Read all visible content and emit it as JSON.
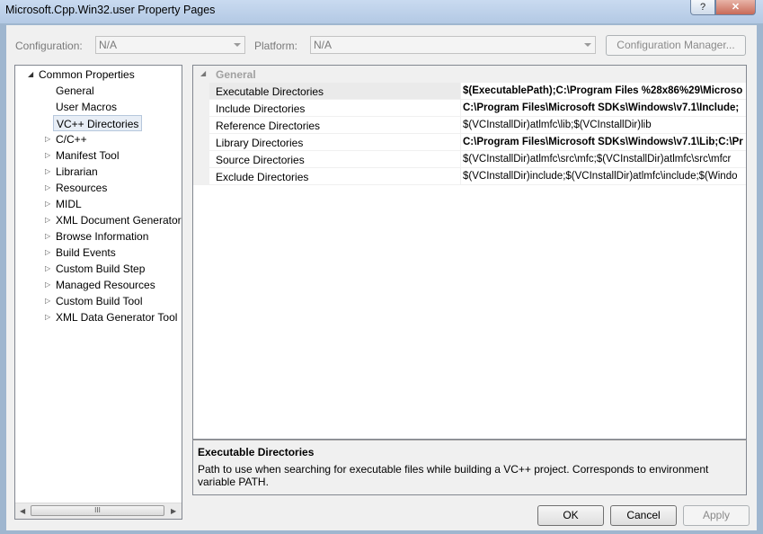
{
  "window": {
    "title": "Microsoft.Cpp.Win32.user Property Pages",
    "help_glyph": "?",
    "close_glyph": "✕"
  },
  "config_row": {
    "configuration_label": "Configuration:",
    "configuration_value": "N/A",
    "platform_label": "Platform:",
    "platform_value": "N/A",
    "config_manager_label": "Configuration Manager..."
  },
  "tree": {
    "root": "Common Properties",
    "items": [
      {
        "label": "General",
        "expandable": false
      },
      {
        "label": "User Macros",
        "expandable": false
      },
      {
        "label": "VC++ Directories",
        "expandable": false,
        "selected": true
      },
      {
        "label": "C/C++",
        "expandable": true
      },
      {
        "label": "Manifest Tool",
        "expandable": true
      },
      {
        "label": "Librarian",
        "expandable": true
      },
      {
        "label": "Resources",
        "expandable": true
      },
      {
        "label": "MIDL",
        "expandable": true
      },
      {
        "label": "XML Document Generator",
        "expandable": true
      },
      {
        "label": "Browse Information",
        "expandable": true
      },
      {
        "label": "Build Events",
        "expandable": true
      },
      {
        "label": "Custom Build Step",
        "expandable": true
      },
      {
        "label": "Managed Resources",
        "expandable": true
      },
      {
        "label": "Custom Build Tool",
        "expandable": true
      },
      {
        "label": "XML Data Generator Tool",
        "expandable": true
      }
    ],
    "scroll_grip": "III"
  },
  "grid": {
    "category": "General",
    "rows": [
      {
        "name": "Executable Directories",
        "value": "$(ExecutablePath);C:\\Program Files %28x86%29\\Microso",
        "bold": true,
        "selected": true
      },
      {
        "name": "Include Directories",
        "value": "C:\\Program Files\\Microsoft SDKs\\Windows\\v7.1\\Include;",
        "bold": true
      },
      {
        "name": "Reference Directories",
        "value": "$(VCInstallDir)atlmfc\\lib;$(VCInstallDir)lib",
        "bold": false
      },
      {
        "name": "Library Directories",
        "value": "C:\\Program Files\\Microsoft SDKs\\Windows\\v7.1\\Lib;C:\\Pr",
        "bold": true
      },
      {
        "name": "Source Directories",
        "value": "$(VCInstallDir)atlmfc\\src\\mfc;$(VCInstallDir)atlmfc\\src\\mfcr",
        "bold": false
      },
      {
        "name": "Exclude Directories",
        "value": "$(VCInstallDir)include;$(VCInstallDir)atlmfc\\include;$(Windo",
        "bold": false
      }
    ]
  },
  "description": {
    "title": "Executable Directories",
    "text": "Path to use when searching for executable files while building a VC++ project.  Corresponds to environment variable PATH."
  },
  "buttons": {
    "ok": "OK",
    "cancel": "Cancel",
    "apply": "Apply"
  }
}
